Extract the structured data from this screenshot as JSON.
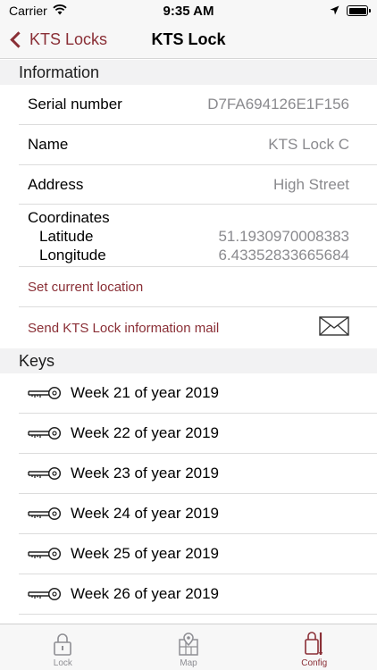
{
  "status": {
    "carrier": "Carrier",
    "time": "9:35 AM"
  },
  "nav": {
    "back_label": "KTS Locks",
    "title": "KTS Lock"
  },
  "information": {
    "header": "Information",
    "serial_label": "Serial number",
    "serial_value": "D7FA694126E1F156",
    "name_label": "Name",
    "name_value": "KTS Lock C",
    "address_label": "Address",
    "address_value": "High Street",
    "coordinates_label": "Coordinates",
    "latitude_label": "Latitude",
    "latitude_value": "51.1930970008383",
    "longitude_label": "Longitude",
    "longitude_value": "6.43352833665684",
    "set_location_label": "Set current location",
    "send_mail_label": "Send KTS Lock information mail"
  },
  "keys": {
    "header": "Keys",
    "items": [
      "Week 21 of year 2019",
      "Week 22 of year 2019",
      "Week 23 of year 2019",
      "Week 24 of year 2019",
      "Week 25 of year 2019",
      "Week 26 of year 2019"
    ]
  },
  "tabs": {
    "lock": "Lock",
    "map": "Map",
    "config": "Config",
    "active": "config"
  },
  "colors": {
    "accent": "#8a2f36",
    "value_gray": "#8a8a8e",
    "header_bg": "#f2f2f3"
  },
  "icons": {
    "wifi": "wifi-icon",
    "location": "location-arrow-icon",
    "battery": "battery-icon",
    "mail": "envelope-icon",
    "key": "key-icon",
    "lock": "padlock-icon",
    "map": "map-icon",
    "config": "config-icon"
  }
}
